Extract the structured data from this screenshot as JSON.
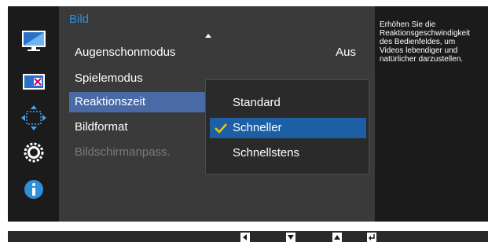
{
  "panel": {
    "title": "Bild"
  },
  "menu": {
    "items": [
      {
        "label": "Augenschonmodus",
        "value": "Aus"
      },
      {
        "label": "Spielemodus"
      },
      {
        "label": "Reaktionszeit"
      },
      {
        "label": "Bildformat"
      },
      {
        "label": "Bildschirmanpass."
      }
    ],
    "selected_index": 2,
    "disabled_index": 4
  },
  "submenu": {
    "options": [
      "Standard",
      "Schneller",
      "Schnellstens"
    ],
    "selected_index": 1
  },
  "help": {
    "text": "Erhöhen Sie die\nReaktionsgeschwindigkeit\ndes Bedienfeldes, um\nVideos lebendiger und\nnatürlicher darzustellen."
  },
  "icons": {
    "categories": [
      "picture-icon",
      "color-icon",
      "size-position-icon",
      "settings-icon",
      "information-icon"
    ],
    "nav_keys": [
      "left-arrow-key-icon",
      "down-arrow-key-icon",
      "up-arrow-key-icon",
      "enter-key-icon"
    ]
  },
  "colors": {
    "accent_blue": "#2f8fd8",
    "selection_blue": "#1d5fa5",
    "menu_highlight": "#4a6aa6",
    "check_yellow": "#f2c200"
  }
}
